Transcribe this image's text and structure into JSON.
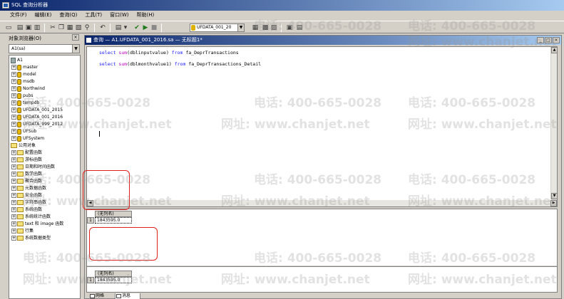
{
  "app": {
    "title": "SQL 查询分析器"
  },
  "menu": [
    "文件(F)",
    "编辑(E)",
    "查询(Q)",
    "工具(T)",
    "窗口(W)",
    "帮助(H)"
  ],
  "toolbar": {
    "database": "UFDATA_001_20"
  },
  "object_explorer": {
    "title": "对象浏览器(O)",
    "server_selector": "A1(sa)",
    "nodes": [
      "A1",
      "master",
      "model",
      "msdb",
      "Northwind",
      "pubs",
      "tempdb",
      "UFDATA_001_2015",
      "UFDATA_001_2016",
      "UFDATA_999_2012",
      "UFSub",
      "UFSystem",
      "公用对象",
      "配置函数",
      "游标函数",
      "日期和时间函数",
      "数学函数",
      "聚合函数",
      "元数据函数",
      "安全函数",
      "字符串函数",
      "系统函数",
      "系统统计函数",
      "text 和 image 函数",
      "行集",
      "系统数据类型"
    ]
  },
  "query_window": {
    "title": "查询 — A1.UFDATA_001_2016.sa — 无标题1*",
    "sql": [
      {
        "kw1": "select",
        "fn": "sum",
        "args": "(dblinputvalue)",
        "kw2": "from",
        "table": "fa_DeprTransactions"
      },
      {
        "kw1": "select",
        "fn": "sum",
        "args": "(dblmonthvalue1)",
        "kw2": "from",
        "table": "fa_DeprTransactions_Detail"
      }
    ]
  },
  "results": [
    {
      "column": "(无列名)",
      "row_number": "1",
      "value": "1843595.0"
    },
    {
      "column": "(无列名)",
      "row_number": "1",
      "value": "1843595.0"
    }
  ],
  "result_tabs": [
    "网格",
    "消息"
  ],
  "watermark": {
    "phone": "电话: 400-665-0028",
    "web": "网址: www.chanjet.net"
  },
  "colors": {
    "title_bar_start": "#0a246a",
    "title_bar_end": "#a6caf0",
    "highlight": "#e0201a",
    "keyword": "#1a1aff"
  }
}
